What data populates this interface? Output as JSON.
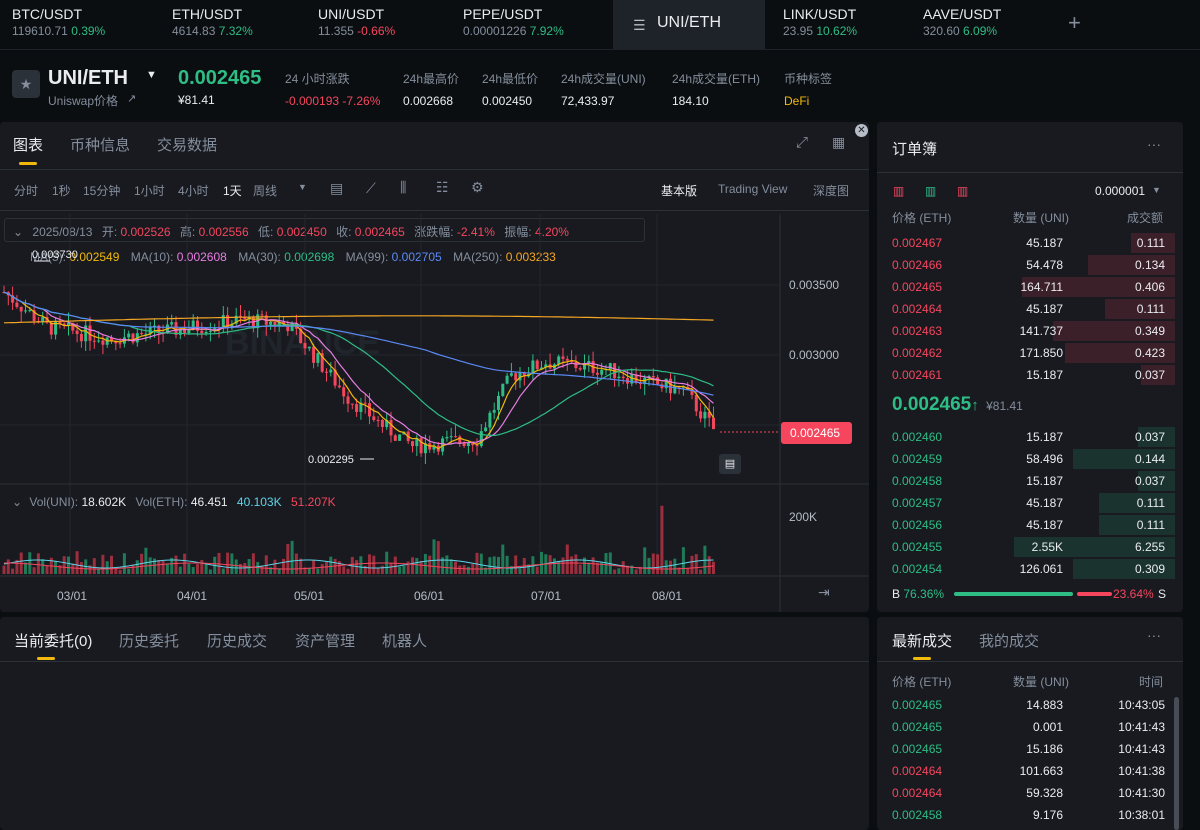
{
  "tabs": [
    {
      "name": "BTC/USDT",
      "price": "119610.71",
      "change": "0.39%",
      "dir": "up"
    },
    {
      "name": "ETH/USDT",
      "price": "4614.83",
      "change": "7.32%",
      "dir": "up"
    },
    {
      "name": "UNI/USDT",
      "price": "11.355",
      "change": "-0.66%",
      "dir": "down"
    },
    {
      "name": "PEPE/USDT",
      "price": "0.00001226",
      "change": "7.92%",
      "dir": "up"
    },
    {
      "name": "UNI/ETH",
      "active": true
    },
    {
      "name": "LINK/USDT",
      "price": "23.95",
      "change": "10.62%",
      "dir": "up"
    },
    {
      "name": "AAVE/USDT",
      "price": "320.60",
      "change": "6.09%",
      "dir": "up"
    }
  ],
  "add_tab": "+",
  "header": {
    "pair": "UNI/ETH",
    "subtitle": "Uniswap价格",
    "price": "0.002465",
    "fiat": "¥81.41",
    "change_label": "24 小时涨跌",
    "change_value": "-0.000193 -7.26%",
    "high_label": "24h最高价",
    "high": "0.002668",
    "low_label": "24h最低价",
    "low": "0.002450",
    "vol_uni_label": "24h成交量(UNI)",
    "vol_uni": "72,433.97",
    "vol_eth_label": "24h成交量(ETH)",
    "vol_eth": "184.10",
    "tag_label": "币种标签",
    "tag": "DeFi"
  },
  "chart_tabs": [
    "图表",
    "币种信息",
    "交易数据"
  ],
  "intervals": [
    "分时",
    "1秒",
    "15分钟",
    "1小时",
    "4小时",
    "1天",
    "周线"
  ],
  "active_interval": "1天",
  "views": [
    "基本版",
    "Trading View",
    "深度图"
  ],
  "ohlc": {
    "date": "2025/08/13",
    "o_label": "开:",
    "o": "0.002526",
    "h_label": "高:",
    "h": "0.002556",
    "l_label": "低:",
    "l": "0.002450",
    "c_label": "收:",
    "c": "0.002465",
    "chg_label": "涨跌幅:",
    "chg": "-2.41%",
    "amp_label": "振幅:",
    "amp": "4.20%"
  },
  "ma": {
    "ma5_label": "MA(5):",
    "ma5": "0.002549",
    "ma10_label": "MA(10):",
    "ma10": "0.002608",
    "ma30_label": "MA(30):",
    "ma30": "0.002698",
    "ma99_label": "MA(99):",
    "ma99": "0.002705",
    "ma250_label": "MA(250):",
    "ma250": "0.003233"
  },
  "vol": {
    "label1": "Vol(UNI):",
    "v1": "18.602K",
    "label2": "Vol(ETH):",
    "v2": "46.451",
    "v3": "40.103K",
    "v4": "51.207K"
  },
  "chart_data": {
    "type": "candlestick",
    "y_ticks": [
      "0.003500",
      "0.003000"
    ],
    "x_ticks": [
      "03/01",
      "04/01",
      "05/01",
      "06/01",
      "07/01",
      "08/01"
    ],
    "vol_tick": "200K",
    "max_label": "0.003730",
    "min_label": "0.002295",
    "last_price": "0.002465",
    "watermark": "BINANCE"
  },
  "colors": {
    "up": "#2ebd85",
    "down": "#f6465d",
    "accent": "#f0b90b"
  },
  "bottom_tabs": [
    "当前委托(0)",
    "历史委托",
    "历史成交",
    "资产管理",
    "机器人"
  ],
  "orderbook": {
    "title": "订单簿",
    "precision": "0.000001",
    "headers": [
      "价格 (ETH)",
      "数量 (UNI)",
      "成交额"
    ],
    "asks": [
      {
        "p": "0.002467",
        "q": "45.187",
        "t": "0.111",
        "d": 0.26
      },
      {
        "p": "0.002466",
        "q": "54.478",
        "t": "0.134",
        "d": 0.51
      },
      {
        "p": "0.002465",
        "q": "164.711",
        "t": "0.406",
        "d": 0.9
      },
      {
        "p": "0.002464",
        "q": "45.187",
        "t": "0.111",
        "d": 0.41
      },
      {
        "p": "0.002463",
        "q": "141.737",
        "t": "0.349",
        "d": 0.72
      },
      {
        "p": "0.002462",
        "q": "171.850",
        "t": "0.423",
        "d": 0.65
      },
      {
        "p": "0.002461",
        "q": "15.187",
        "t": "0.037",
        "d": 0.2
      }
    ],
    "mid_price": "0.002465",
    "mid_arrow": "↑",
    "mid_fiat": "¥81.41",
    "bids": [
      {
        "p": "0.002460",
        "q": "15.187",
        "t": "0.037",
        "d": 0.22
      },
      {
        "p": "0.002459",
        "q": "58.496",
        "t": "0.144",
        "d": 0.6
      },
      {
        "p": "0.002458",
        "q": "15.187",
        "t": "0.037",
        "d": 0.22
      },
      {
        "p": "0.002457",
        "q": "45.187",
        "t": "0.111",
        "d": 0.45
      },
      {
        "p": "0.002456",
        "q": "45.187",
        "t": "0.111",
        "d": 0.45
      },
      {
        "p": "0.002455",
        "q": "2.55K",
        "t": "6.255",
        "d": 0.95
      },
      {
        "p": "0.002454",
        "q": "126.061",
        "t": "0.309",
        "d": 0.6
      }
    ],
    "b_label": "B",
    "b_pct": "76.36%",
    "s_pct": "23.64%",
    "s_label": "S",
    "b_ratio": 0.7636
  },
  "trades": {
    "tab1": "最新成交",
    "tab2": "我的成交",
    "headers": [
      "价格 (ETH)",
      "数量 (UNI)",
      "时间"
    ],
    "rows": [
      {
        "p": "0.002465",
        "q": "14.883",
        "t": "10:43:05",
        "dir": "up"
      },
      {
        "p": "0.002465",
        "q": "0.001",
        "t": "10:41:43",
        "dir": "up"
      },
      {
        "p": "0.002465",
        "q": "15.186",
        "t": "10:41:43",
        "dir": "up"
      },
      {
        "p": "0.002464",
        "q": "101.663",
        "t": "10:41:38",
        "dir": "down"
      },
      {
        "p": "0.002464",
        "q": "59.328",
        "t": "10:41:30",
        "dir": "down"
      },
      {
        "p": "0.002458",
        "q": "9.176",
        "t": "10:38:01",
        "dir": "up"
      }
    ]
  }
}
